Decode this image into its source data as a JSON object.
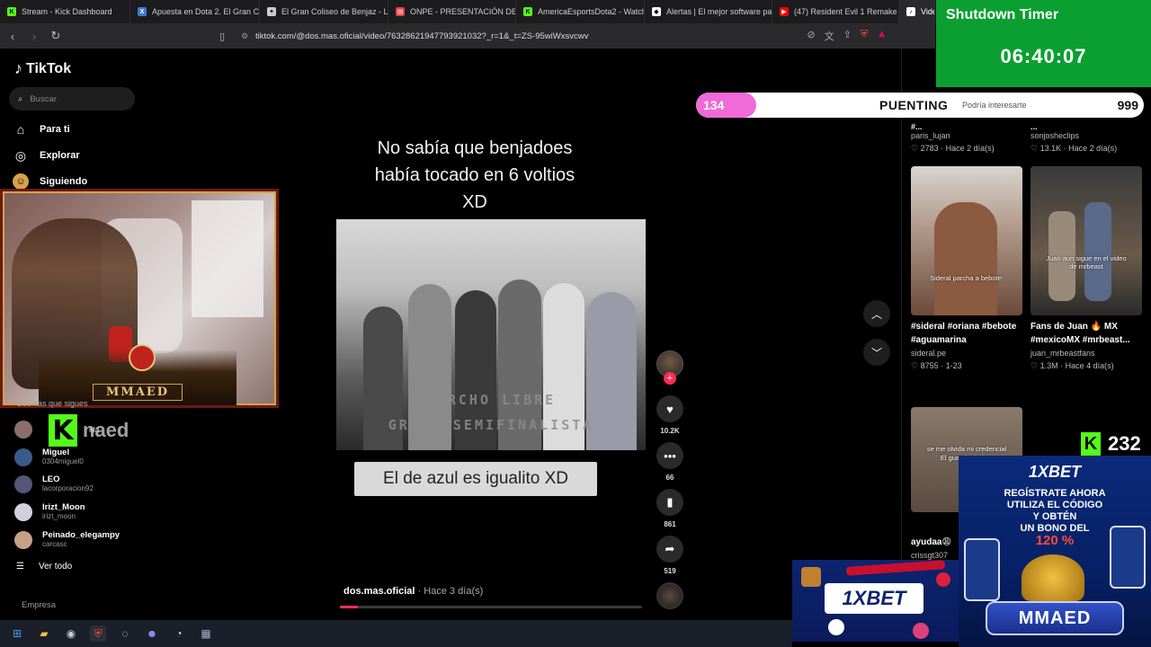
{
  "browser": {
    "tabs": [
      {
        "title": "Stream - Kick Dashboard",
        "color": "#53fc18",
        "glyph": "K"
      },
      {
        "title": "Apuesta en Dota 2. El Gran Col",
        "color": "#3a7bd5",
        "glyph": "X"
      },
      {
        "title": "El Gran Coliseo de Benjaz - Liq",
        "color": "#cccccc",
        "glyph": "✦"
      },
      {
        "title": "ONPE - PRESENTACIÓN DE RE",
        "color": "#e04040",
        "glyph": "▤"
      },
      {
        "title": "AmericaEsportsDota2 - Watch",
        "color": "#53fc18",
        "glyph": "K"
      },
      {
        "title": "Alertas | El mejor software par",
        "color": "#ffffff",
        "glyph": "◆"
      },
      {
        "title": "(47) Resident Evil 1 Remake - ",
        "color": "#ff0000",
        "glyph": "▶"
      },
      {
        "title": "Vide",
        "color": "#ffffff",
        "glyph": "♪"
      }
    ],
    "url": "tiktok.com/@dos.mas.oficial/video/7632862194779392103​2?_r=1&_t=ZS-95wiWxsvcwv"
  },
  "sidebar": {
    "logo": "TikTok",
    "search_placeholder": "Buscar",
    "nav": [
      {
        "label": "Para ti",
        "icon": "home-icon",
        "glyph": "⌂"
      },
      {
        "label": "Explorar",
        "icon": "compass-icon",
        "glyph": "◎"
      },
      {
        "label": "Siguiendo",
        "icon": "following-icon",
        "glyph": "☺"
      }
    ],
    "following_title": "Cuentas que sigues",
    "following": [
      {
        "name": "ela",
        "handle": "",
        "color": "#8a6f6a"
      },
      {
        "name": "Miguel",
        "handle": "0304miguel0",
        "color": "#3a5a8a"
      },
      {
        "name": "LEO",
        "handle": "lacorporacion92",
        "color": "#555577"
      },
      {
        "name": "Irizt_Moon",
        "handle": "irizt_moon",
        "color": "#d0d0e0"
      },
      {
        "name": "Peinado_elegampy",
        "handle": "carcasc",
        "color": "#c8a088"
      }
    ],
    "ver_todo": "Ver todo",
    "empresa": "Empresa"
  },
  "webcam": {
    "crest_label": "MMAED"
  },
  "kick_overlay": {
    "name": "naed"
  },
  "video": {
    "caption": [
      "No sabía que benjadoes",
      "había tocado en 6 voltios",
      "XD"
    ],
    "photo_text_1": "CORCHO LIBRE",
    "photo_text_2": "GRUPO SEMIFINALISTA",
    "subtitle": "El de azul es igualito XD",
    "author": "dos.mas.oficial",
    "time_ago": "· Hace 3 día(s)",
    "progress": 0.06
  },
  "rail": {
    "likes": "10.2K",
    "comments": "66",
    "saves": "861",
    "shares": "519"
  },
  "shutdown": {
    "title": "Shutdown Timer",
    "time": "06:40:07"
  },
  "puenting": {
    "current": "134",
    "label": "PUENTING",
    "goal": "999",
    "under_text": "Podría interesarte",
    "progress": 0.134
  },
  "recommendations": {
    "top_row": [
      {
        "channel": "paris_lujan",
        "stats": "♡ 2783  · Hace 2 día(s)"
      },
      {
        "channel": "sonjosheclips",
        "stats": "♡ 13.1K · Hace 2 día(s)"
      }
    ],
    "middle_row": [
      {
        "caption": "Sideral parcha a bebote:",
        "title": "#sideral #oriana #bebote #aguamarina",
        "channel": "sideral.pe",
        "stats": "♡ 8755 · 1-23"
      },
      {
        "caption": "Juan aun sigue en el video de mrbeast",
        "title": "Fans de Juan 🔥 MX #mexicoMX #mrbeast...",
        "channel": "juan_mrbeastfans",
        "stats": "♡ 1.3M · Hace 4 día(s)"
      }
    ],
    "bottom": {
      "caption": "se me olvida mi credencial",
      "caption2": "El guardia de la...",
      "title": "ayudaa😩",
      "channel": "crissgt307"
    }
  },
  "kick_count": "232",
  "ads": {
    "brand": "1XBET",
    "line1": "REGÍSTRATE AHORA",
    "line2": "UTILIZA EL CÓDIGO",
    "line3": "Y OBTÉN",
    "line4": "UN BONO DEL",
    "percent": "120 %",
    "code": "MMAED",
    "small_brand": "1XBET"
  }
}
